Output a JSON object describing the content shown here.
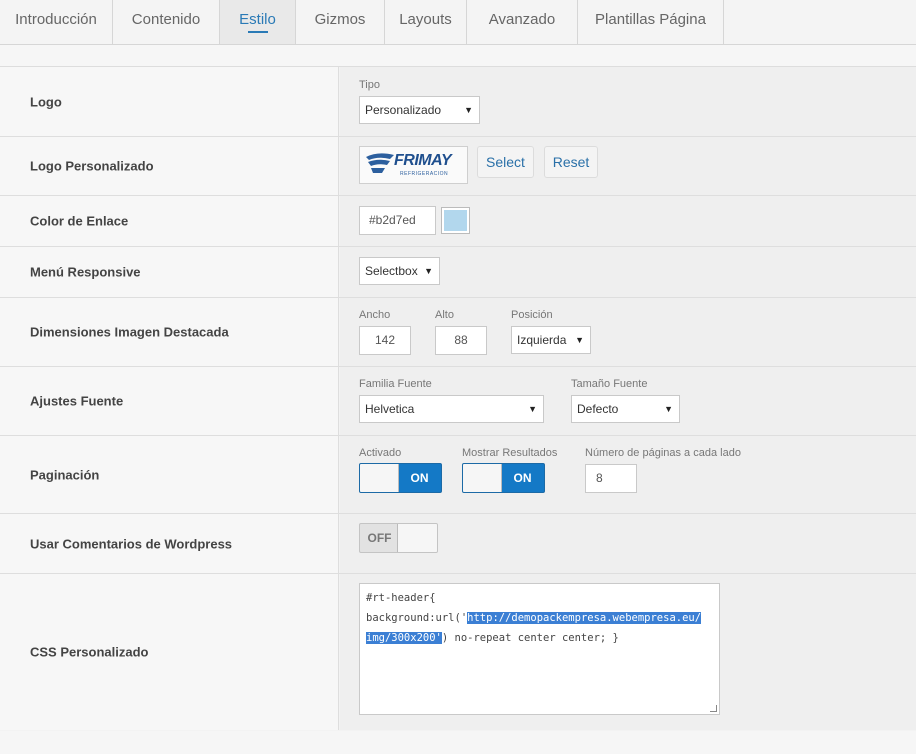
{
  "tabs": [
    {
      "label": "Introducción",
      "active": false
    },
    {
      "label": "Contenido",
      "active": false
    },
    {
      "label": "Estilo",
      "active": true
    },
    {
      "label": "Gizmos",
      "active": false
    },
    {
      "label": "Layouts",
      "active": false
    },
    {
      "label": "Avanzado",
      "active": false
    },
    {
      "label": "Plantillas Página",
      "active": false
    }
  ],
  "rows": {
    "logo": {
      "label": "Logo",
      "type_caption": "Tipo",
      "type_value": "Personalizado"
    },
    "custom_logo": {
      "label": "Logo Personalizado",
      "logo_text": "FRIMAY",
      "logo_subtext": "REFRIGERACION",
      "select_label": "Select",
      "reset_label": "Reset"
    },
    "link_color": {
      "label": "Color de Enlace",
      "value": "#b2d7ed",
      "swatch_color": "#b2d7ed"
    },
    "responsive_menu": {
      "label": "Menú Responsive",
      "value": "Selectbox"
    },
    "featured_image": {
      "label": "Dimensiones Imagen Destacada",
      "width_caption": "Ancho",
      "width_value": "142",
      "height_caption": "Alto",
      "height_value": "88",
      "position_caption": "Posición",
      "position_value": "Izquierda"
    },
    "font": {
      "label": "Ajustes Fuente",
      "family_caption": "Familia Fuente",
      "family_value": "Helvetica",
      "size_caption": "Tamaño Fuente",
      "size_value": "Defecto"
    },
    "pagination": {
      "label": "Paginación",
      "enabled_caption": "Activado",
      "enabled_state": "ON",
      "results_caption": "Mostrar Resultados",
      "results_state": "ON",
      "pages_caption": "Número de páginas a cada lado",
      "pages_value": "8"
    },
    "wp_comments": {
      "label": "Usar Comentarios de Wordpress",
      "state": "OFF"
    },
    "custom_css": {
      "label": "CSS Personalizado",
      "line1": "#rt-header{",
      "line2_pre": "background:url('",
      "line2_hl": "http://demopackempresa.webempresa.eu/",
      "line3_hl": "img/300x200'",
      "line3_post": ") no-repeat center center; }"
    }
  },
  "colors": {
    "accent": "#2a7ab6",
    "toggle_on": "#1479c6"
  }
}
